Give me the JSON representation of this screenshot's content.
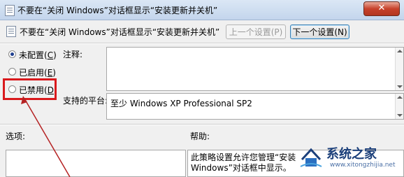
{
  "window": {
    "title": "不要在“关闭 Windows”对话框显示“安装更新并关机”",
    "close_glyph": "✕"
  },
  "header": {
    "setting_name": "不要在“关闭 Windows”对话框显示“安装更新并关机”",
    "prev_button": "上一个设置(P)",
    "next_button": "下一个设置(N)"
  },
  "options": {
    "not_configured": {
      "label": "未配置",
      "key": "C",
      "checked": true
    },
    "enabled": {
      "label": "已启用",
      "key": "E",
      "checked": false
    },
    "disabled": {
      "label": "已禁用",
      "key": "D",
      "checked": false
    }
  },
  "comment": {
    "label": "注释:",
    "value": ""
  },
  "supported": {
    "label": "支持的平台:",
    "value": "至少 Windows XP Professional SP2"
  },
  "options_section": {
    "label": "选项:"
  },
  "help_section": {
    "label": "帮助:",
    "line1": "此策略设置允许您管理“安装",
    "line2": "Windows”对话框中显示。"
  },
  "watermark": {
    "title": "系统之家",
    "url": "www.xitongzhijia.net"
  },
  "colors": {
    "highlight": "#d9191c",
    "accent": "#1b3f7a"
  }
}
